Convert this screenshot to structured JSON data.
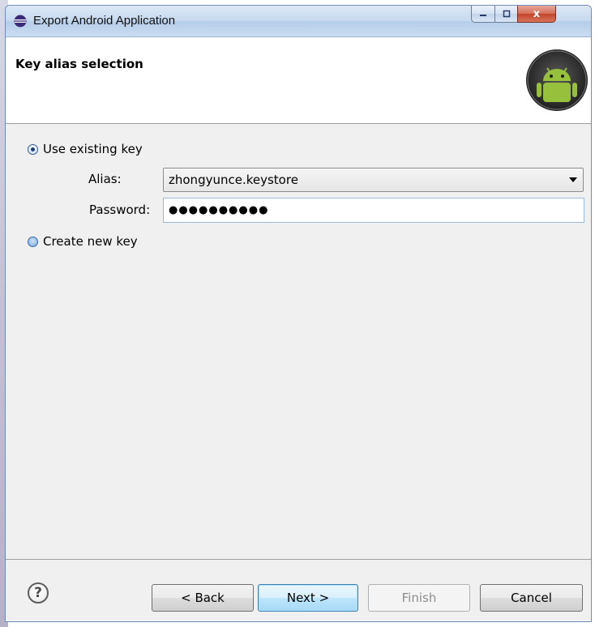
{
  "window": {
    "title": "Export Android Application",
    "controls": {
      "minimize": "—",
      "maximize": "▢",
      "close": "x"
    }
  },
  "banner": {
    "title": "Key alias selection"
  },
  "form": {
    "use_existing_label": "Use existing key",
    "alias_label": "Alias:",
    "alias_value": "zhongyunce.keystore",
    "password_label": "Password:",
    "password_value": "●●●●●●●●●●",
    "create_new_label": "Create new key"
  },
  "footer": {
    "help": "?",
    "back": "< Back",
    "next": "Next >",
    "finish": "Finish",
    "cancel": "Cancel"
  },
  "colors": {
    "accent": "#3c7fb1",
    "android_green": "#97c03d"
  }
}
